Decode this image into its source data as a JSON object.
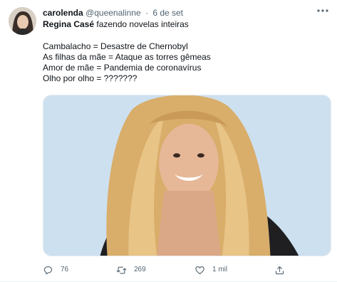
{
  "tweet": {
    "display_name": "carolenda",
    "handle": "@queenalinne",
    "separator": "·",
    "date": "6 de set",
    "more_icon": "ellipsis-icon",
    "title_bold": "Regina Casé",
    "title_rest": " fazendo novelas inteiras",
    "lines": [
      "Cambalacho = Desastre de Chernobyl",
      "As filhas da mãe = Ataque as torres gêmeas",
      "Amor de mãe = Pandemia de coronavírus",
      "Olho por olho = ???????"
    ],
    "actions": {
      "reply": {
        "icon": "reply-icon",
        "count": "76"
      },
      "retweet": {
        "icon": "retweet-icon",
        "count": "269"
      },
      "like": {
        "icon": "heart-icon",
        "count": "1 mil"
      },
      "share": {
        "icon": "share-icon"
      }
    },
    "colors": {
      "text": "#0f1419",
      "secondary": "#536471",
      "media_background": "#cde0ef"
    }
  }
}
